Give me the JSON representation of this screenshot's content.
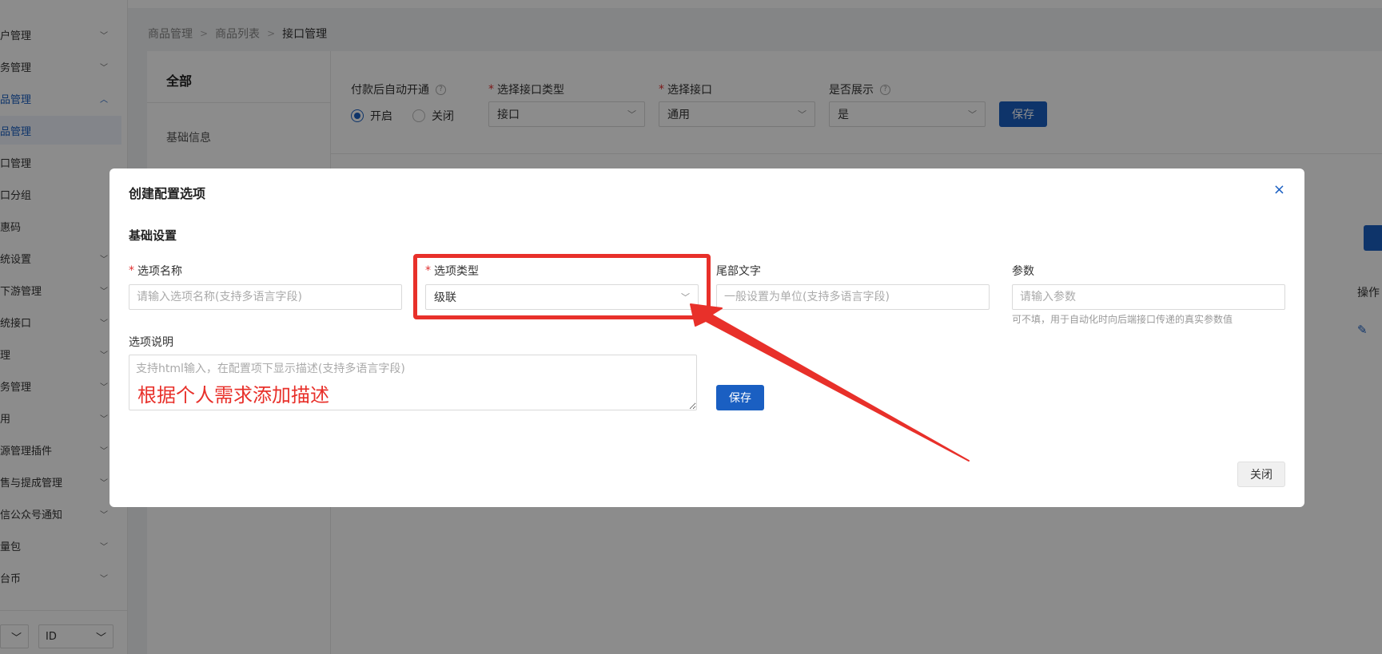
{
  "sidebar": {
    "items": [
      {
        "label": "户管理",
        "expanded": false
      },
      {
        "label": "务管理",
        "expanded": false
      },
      {
        "label": "品管理",
        "expanded": true
      },
      {
        "label": "品管理",
        "active": true
      },
      {
        "label": "口管理"
      },
      {
        "label": "口分组"
      },
      {
        "label": "惠码"
      },
      {
        "label": "统设置",
        "expanded": false
      },
      {
        "label": "下游管理",
        "expanded": false
      },
      {
        "label": "统接口",
        "expanded": false
      },
      {
        "label": "理",
        "expanded": false
      },
      {
        "label": "务管理",
        "expanded": false
      },
      {
        "label": "用",
        "expanded": false
      },
      {
        "label": "源管理插件",
        "expanded": false
      },
      {
        "label": "售与提成管理",
        "expanded": false
      },
      {
        "label": "信公众号通知",
        "expanded": false
      },
      {
        "label": "量包",
        "expanded": false
      },
      {
        "label": "台币",
        "expanded": false
      }
    ],
    "bottom_select_left": "",
    "bottom_select_right": "ID"
  },
  "breadcrumb": [
    "商品管理",
    "商品列表",
    "接口管理"
  ],
  "panel": {
    "left_title": "全部",
    "left_item": "基础信息",
    "auto_open_label": "付款后自动开通",
    "radio_on": "开启",
    "radio_off": "关闭",
    "interface_type_label": "选择接口类型",
    "interface_type_value": "接口",
    "interface_label": "选择接口",
    "interface_value": "通用",
    "display_label": "是否展示",
    "display_value": "是",
    "save_label": "保存",
    "op_header": "操作"
  },
  "modal": {
    "title": "创建配置选项",
    "close_glyph": "×",
    "section": "基础设置",
    "option_name_label": "选项名称",
    "option_name_placeholder": "请输入选项名称(支持多语言字段)",
    "option_type_label": "选项类型",
    "option_type_value": "级联",
    "suffix_label": "尾部文字",
    "suffix_placeholder": "一般设置为单位(支持多语言字段)",
    "param_label": "参数",
    "param_placeholder": "请输入参数",
    "param_hint": "可不填，用于自动化时向后端接口传递的真实参数值",
    "desc_label": "选项说明",
    "desc_placeholder": "支持html输入，在配置项下显示描述(支持多语言字段)",
    "annotation": "根据个人需求添加描述",
    "save_label": "保存",
    "close_label": "关闭"
  },
  "colors": {
    "primary": "#1a5fc2",
    "annotation_red": "#e8302a",
    "required_red": "#e03030"
  }
}
